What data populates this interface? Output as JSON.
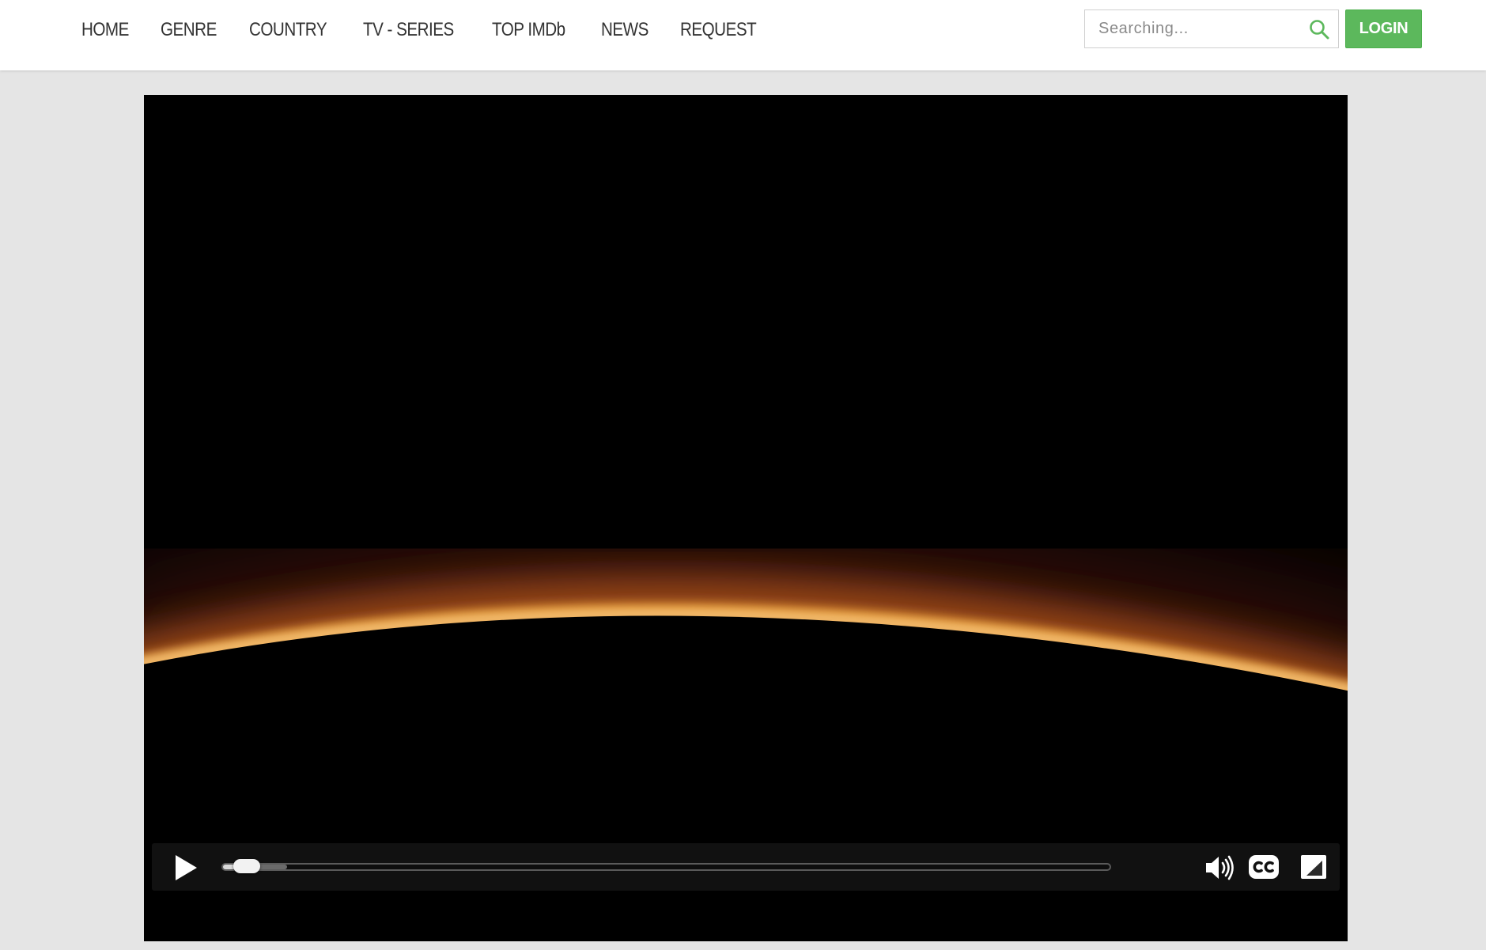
{
  "nav": {
    "items": [
      {
        "label": "HOME"
      },
      {
        "label": "GENRE"
      },
      {
        "label": "COUNTRY"
      },
      {
        "label": "TV - SERIES"
      },
      {
        "label": "TOP IMDb"
      },
      {
        "label": "NEWS"
      },
      {
        "label": "REQUEST"
      }
    ]
  },
  "search": {
    "placeholder": "Searching...",
    "value": "",
    "icon": "search-icon"
  },
  "login": {
    "label": "LOGIN"
  },
  "colors": {
    "accent": "#5cb85c",
    "page_background": "#e5e5e5",
    "header_background": "#ffffff",
    "player_background": "#000000"
  },
  "player": {
    "playback_fraction": 0.027,
    "buffered_fraction": 0.072,
    "controls": [
      "play-icon",
      "volume-icon",
      "closed-captions-icon",
      "fullscreen-icon"
    ]
  }
}
